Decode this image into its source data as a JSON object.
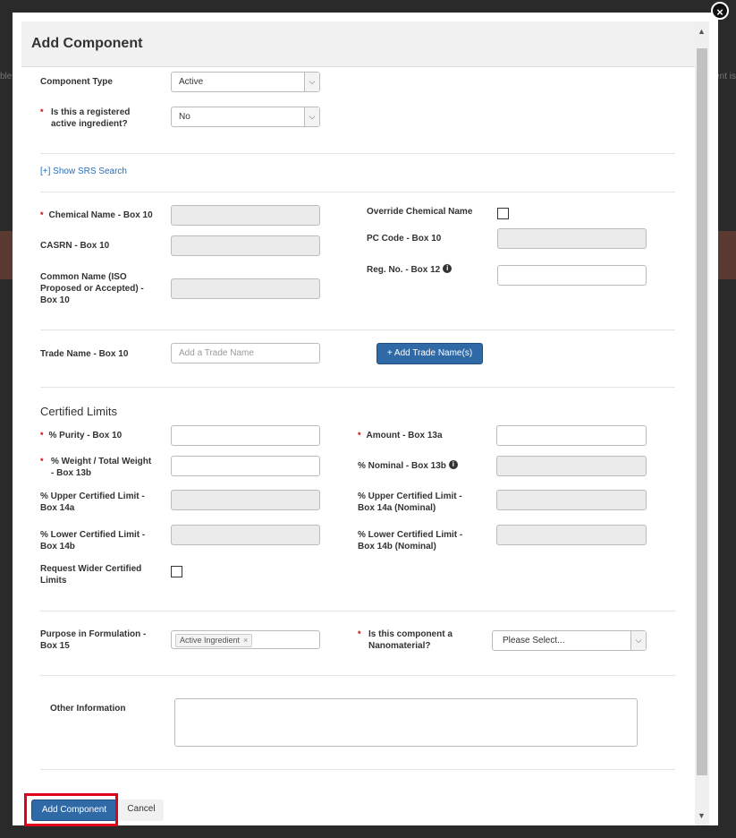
{
  "modal": {
    "title": "Add Component",
    "close_icon": "close-icon"
  },
  "background": {
    "left_text": "ble",
    "right_text": "onent is"
  },
  "form": {
    "component_type": {
      "label": "Component Type",
      "value": "Active"
    },
    "registered_ai": {
      "label": "Is this a registered active ingredient?",
      "value": "No"
    },
    "srs_link": "[+] Show SRS Search",
    "chemical_name": {
      "label": "Chemical Name - Box 10",
      "value": ""
    },
    "casrn": {
      "label": "CASRN - Box 10",
      "value": ""
    },
    "common_name": {
      "label": "Common Name (ISO Proposed or Accepted) - Box 10",
      "value": ""
    },
    "override_chemical_name": {
      "label": "Override Chemical Name",
      "checked": false
    },
    "pc_code": {
      "label": "PC Code - Box 10",
      "value": ""
    },
    "reg_no": {
      "label": "Reg. No. - Box 12",
      "value": ""
    },
    "trade_name": {
      "label": "Trade Name - Box 10",
      "placeholder": "Add a Trade Name"
    },
    "add_trade_name_button": "+ Add Trade Name(s)",
    "certified_limits_title": "Certified Limits",
    "purity": {
      "label": "% Purity - Box 10",
      "value": ""
    },
    "weight": {
      "label": "% Weight / Total Weight - Box 13b",
      "value": ""
    },
    "upper_limit": {
      "label": "% Upper Certified Limit - Box 14a",
      "value": ""
    },
    "lower_limit": {
      "label": "% Lower Certified Limit - Box 14b",
      "value": ""
    },
    "wider_limits": {
      "label": "Request Wider Certified Limits",
      "checked": false
    },
    "amount": {
      "label": "Amount - Box 13a",
      "value": ""
    },
    "nominal": {
      "label": "% Nominal - Box 13b",
      "value": ""
    },
    "upper_limit_nominal": {
      "label": "% Upper Certified Limit - Box 14a (Nominal)",
      "value": ""
    },
    "lower_limit_nominal": {
      "label": "% Lower Certified Limit - Box 14b (Nominal)",
      "value": ""
    },
    "purpose": {
      "label": "Purpose in Formulation - Box 15",
      "tag": "Active Ingredient",
      "tag_remove": "×"
    },
    "nanomaterial": {
      "label": "Is this component a Nanomaterial?",
      "value": "Please Select..."
    },
    "other_info": {
      "label": "Other Information",
      "value": ""
    }
  },
  "buttons": {
    "add_component": "Add Component",
    "cancel": "Cancel"
  },
  "glyphs": {
    "required": "*",
    "chevron": "⌵",
    "info": "i",
    "close": "×",
    "scroll_up": "▲",
    "scroll_down": "▼"
  },
  "colors": {
    "primary": "#2f6aa7",
    "required": "#cc0000",
    "highlight": "#e0001b",
    "link": "#2a6ebb"
  }
}
